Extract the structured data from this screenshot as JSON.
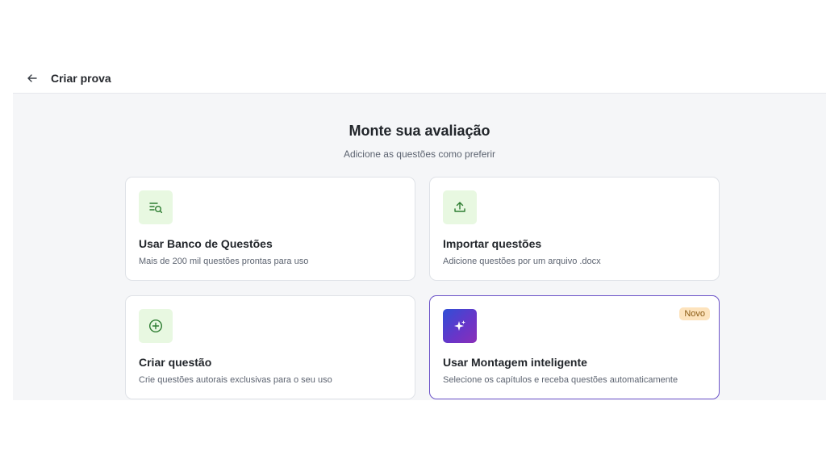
{
  "header": {
    "back_icon": "arrow-left-icon",
    "title": "Criar prova"
  },
  "main": {
    "heading": "Monte sua avaliação",
    "subheading": "Adicione as questões como preferir"
  },
  "cards": [
    {
      "icon": "list-search-icon",
      "title": "Usar Banco de Questões",
      "description": "Mais de 200 mil questões prontas para uso"
    },
    {
      "icon": "upload-icon",
      "title": "Importar questões",
      "description": "Adicione questões por um arquivo .docx"
    },
    {
      "icon": "plus-circle-icon",
      "title": "Criar questão",
      "description": "Crie questões autorais exclusivas para o seu uso"
    },
    {
      "icon": "sparkles-icon",
      "title": "Usar Montagem inteligente",
      "description": "Selecione os capítulos e receba questões automaticamente",
      "badge": "Novo"
    }
  ],
  "colors": {
    "icon_green": "#2e7d32",
    "icon_bg": "#e8f8e1",
    "accent_purple": "#6b52c8",
    "badge_bg": "#fde3bd"
  }
}
